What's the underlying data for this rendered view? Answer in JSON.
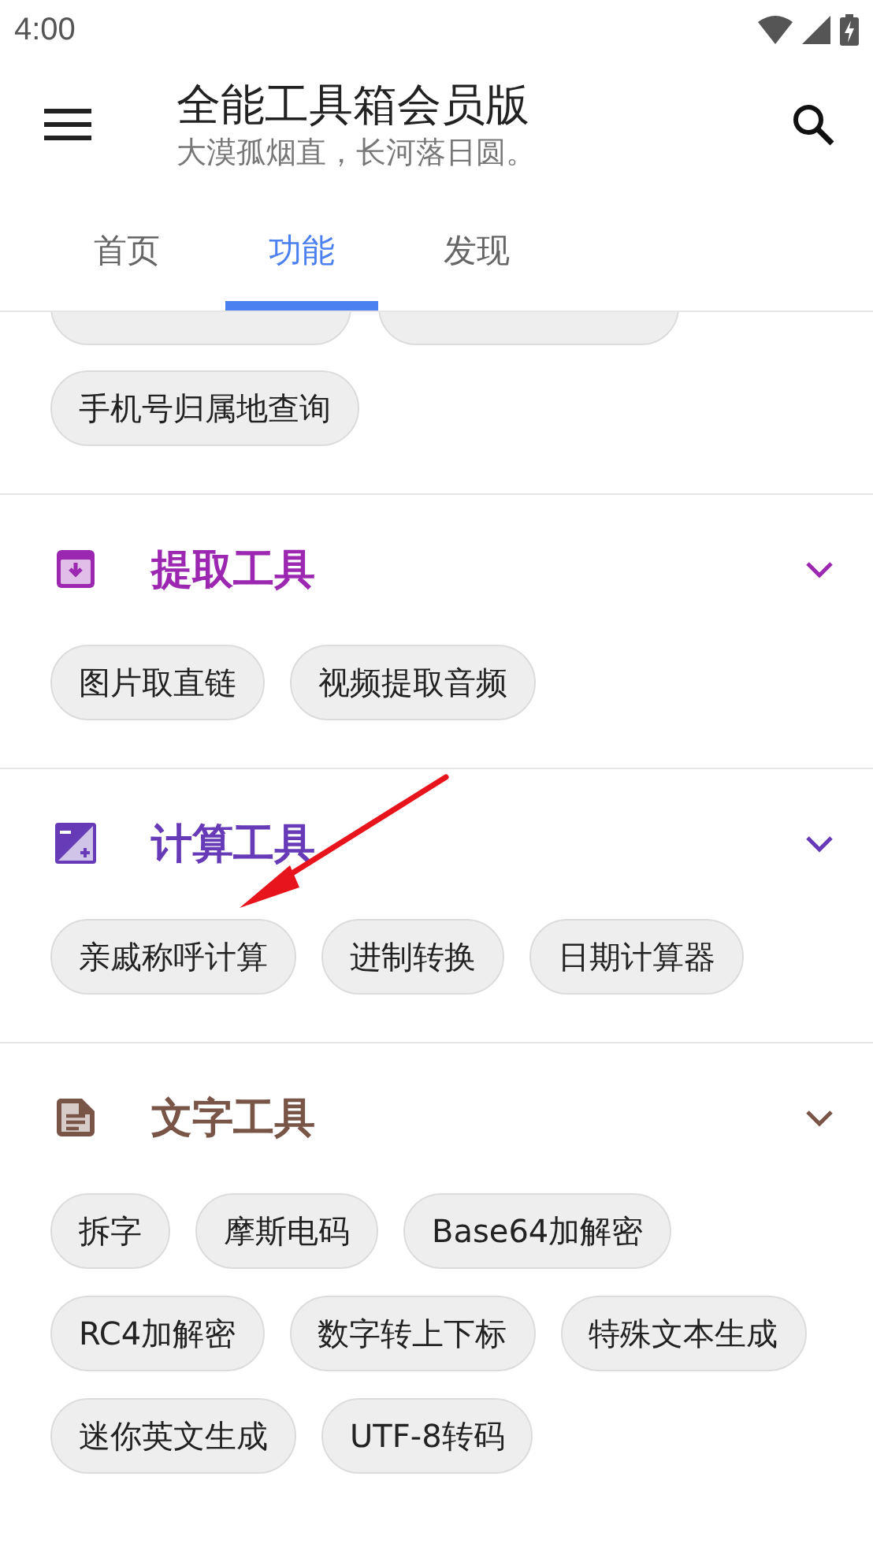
{
  "status_bar": {
    "time": "4:00"
  },
  "toolbar": {
    "title": "全能工具箱会员版",
    "subtitle": "大漠孤烟直，长河落日圆。"
  },
  "tabs": [
    {
      "label": "首页",
      "selected": false
    },
    {
      "label": "功能",
      "selected": true
    },
    {
      "label": "发现",
      "selected": false
    }
  ],
  "sections": [
    {
      "kind": "partial",
      "chips": [
        "手机号归属地查询"
      ]
    },
    {
      "kind": "extract",
      "title": "提取工具",
      "color": "#9c27b0",
      "chips": [
        "图片取直链",
        "视频提取音频"
      ]
    },
    {
      "kind": "calc",
      "title": "计算工具",
      "color": "#673ab7",
      "chips": [
        "亲戚称呼计算",
        "进制转换",
        "日期计算器"
      ]
    },
    {
      "kind": "text",
      "title": "文字工具",
      "color": "#795548",
      "chips": [
        "拆字",
        "摩斯电码",
        "Base64加解密",
        "RC4加解密",
        "数字转上下标",
        "特殊文本生成",
        "迷你英文生成",
        "UTF-8转码"
      ]
    }
  ]
}
